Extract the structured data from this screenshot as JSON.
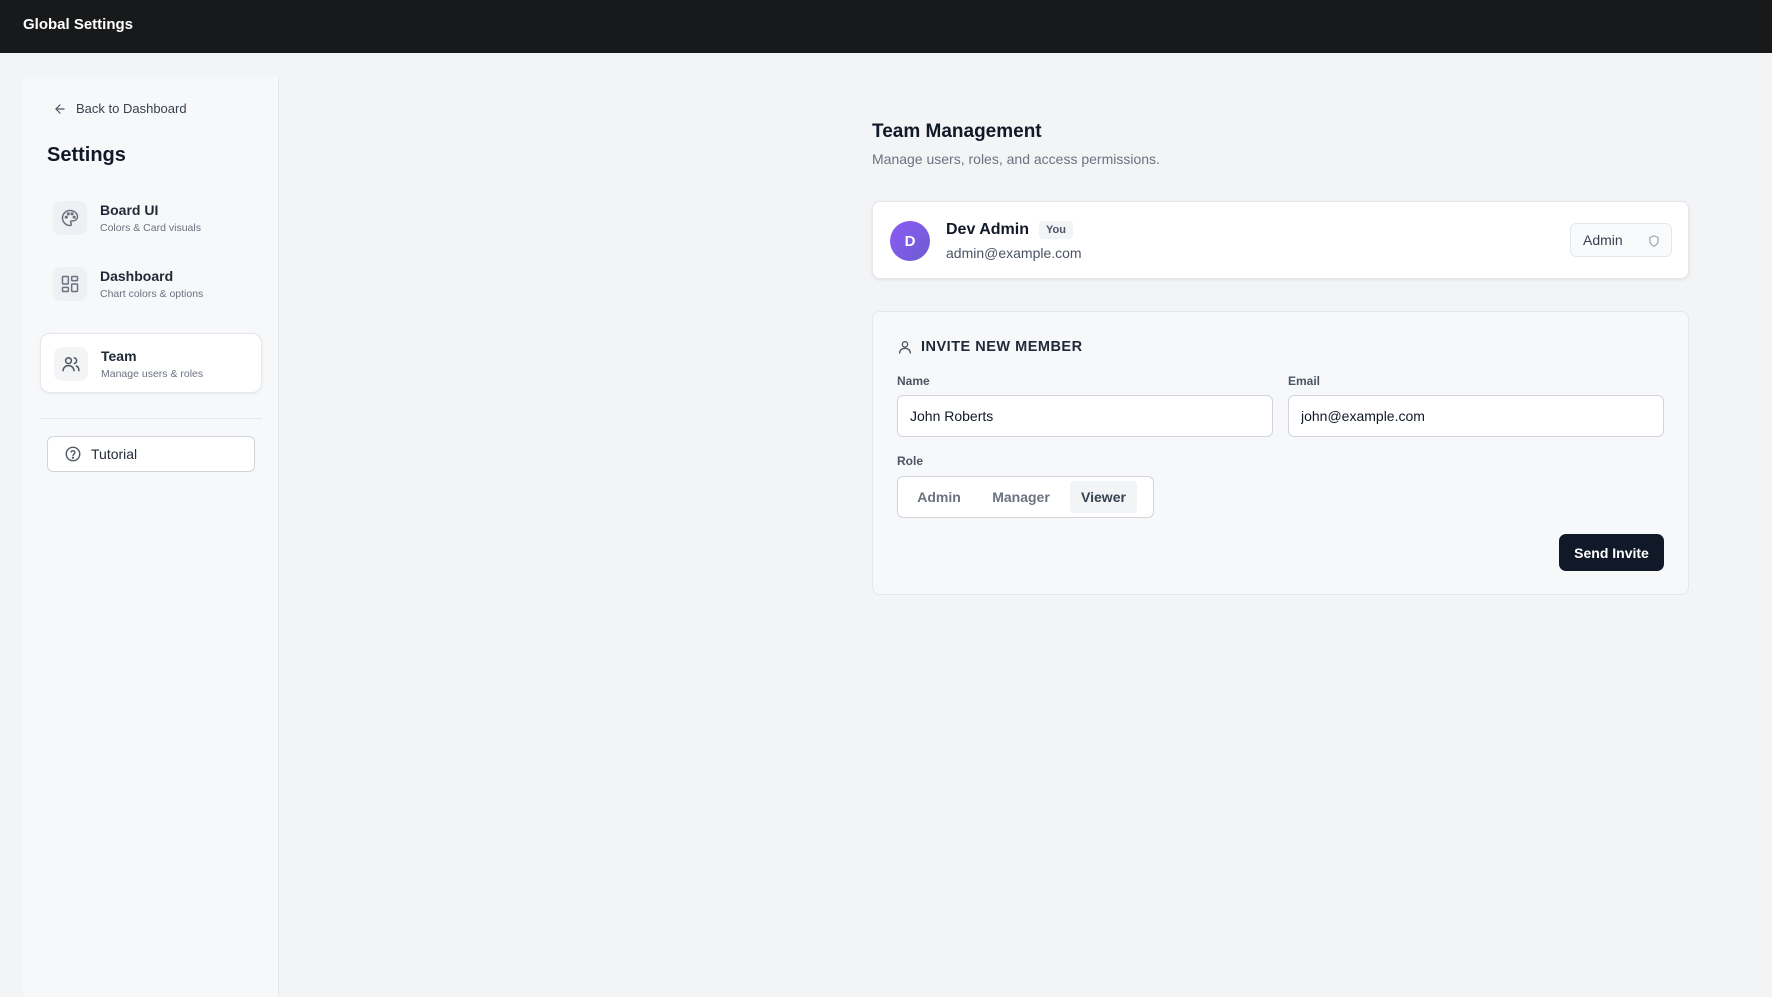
{
  "topbar": {
    "title": "Global Settings"
  },
  "sidebar": {
    "back_label": "Back to Dashboard",
    "heading": "Settings",
    "items": [
      {
        "label": "Board UI",
        "sub": "Colors & Card visuals",
        "icon": "palette-icon"
      },
      {
        "label": "Dashboard",
        "sub": "Chart colors & options",
        "icon": "dashboard-grid-icon"
      },
      {
        "label": "Team",
        "sub": "Manage users & roles",
        "icon": "users-icon",
        "active": true
      }
    ],
    "tutorial_label": "Tutorial"
  },
  "main": {
    "title": "Team Management",
    "subtitle": "Manage users, roles, and access permissions.",
    "member": {
      "initial": "D",
      "name": "Dev Admin",
      "badge": "You",
      "email": "admin@example.com",
      "role": "Admin"
    },
    "invite": {
      "heading": "INVITE NEW MEMBER",
      "name_label": "Name",
      "name_value": "John Roberts",
      "email_label": "Email",
      "email_value": "john@example.com",
      "role_label": "Role",
      "roles": [
        "Admin",
        "Manager",
        "Viewer"
      ],
      "selected_role": "Viewer",
      "send_label": "Send Invite"
    }
  },
  "colors": {
    "topbar": "#18191b",
    "accent": "#111827",
    "avatar": "#7c5ce0"
  }
}
